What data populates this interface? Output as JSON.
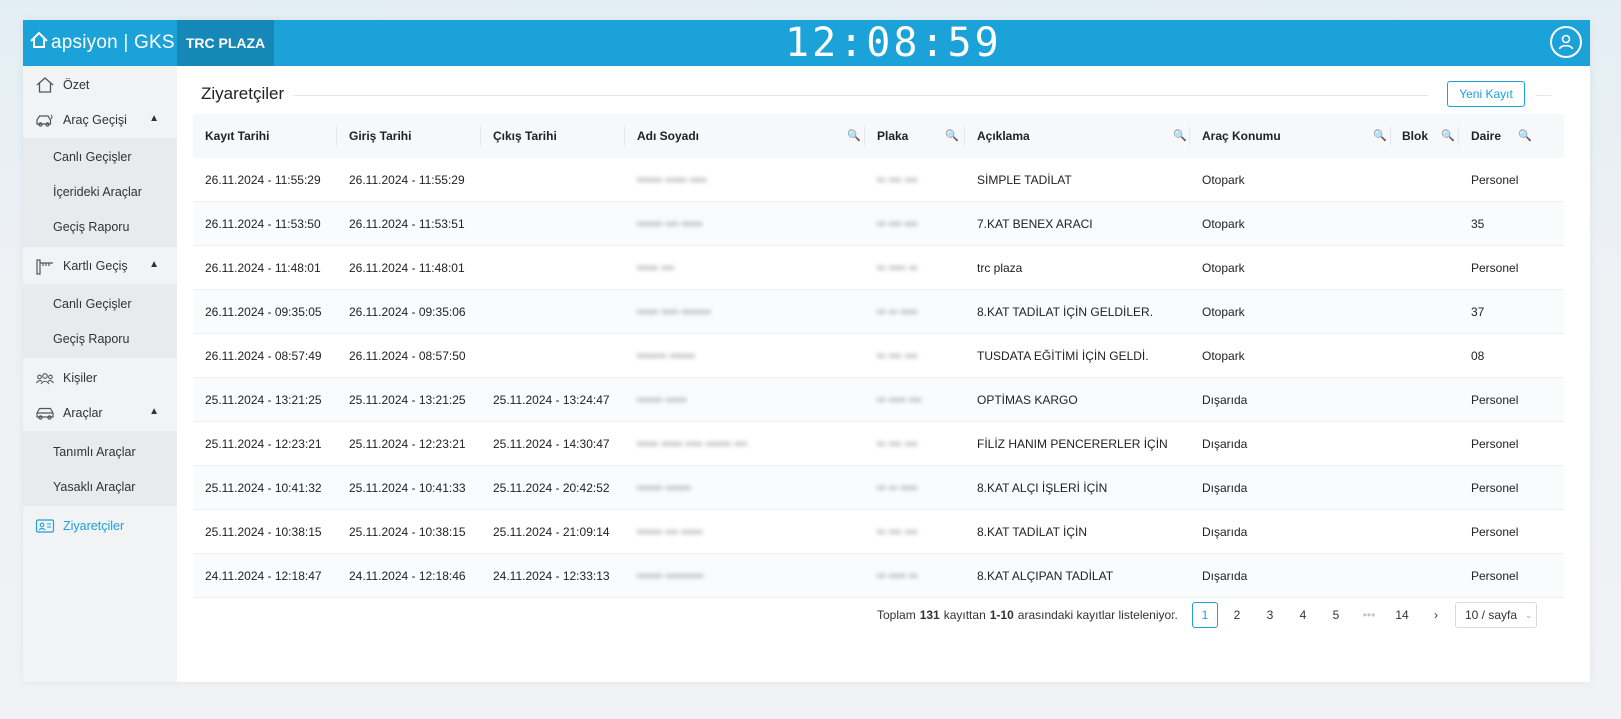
{
  "topbar": {
    "brand": "apsiyon | GKS",
    "site": "TRC PLAZA",
    "clock": "12:08:59"
  },
  "sidebar": {
    "summary": "Özet",
    "vehicle_pass": {
      "label": "Araç Geçişi",
      "items": [
        "Canlı Geçişler",
        "İçerideki Araçlar",
        "Geçiş Raporu"
      ]
    },
    "card_pass": {
      "label": "Kartlı Geçiş",
      "items": [
        "Canlı Geçişler",
        "Geçiş Raporu"
      ]
    },
    "people": "Kişiler",
    "vehicles": {
      "label": "Araçlar",
      "items": [
        "Tanımlı Araçlar",
        "Yasaklı Araçlar"
      ]
    },
    "visitors": "Ziyaretçiler"
  },
  "main": {
    "title": "Ziyaretçiler",
    "new_button": "Yeni Kayıt",
    "columns": [
      "Kayıt Tarihi",
      "Giriş Tarihi",
      "Çıkış Tarihi",
      "Adı Soyadı",
      "Plaka",
      "Açıklama",
      "Araç Konumu",
      "Blok",
      "Daire"
    ],
    "rows": [
      {
        "kayit": "26.11.2024 - 11:55:29",
        "giris": "26.11.2024 - 11:55:29",
        "cikis": "",
        "ad": "•••••• ••••• ••••",
        "plaka": "•• ••• •••",
        "aciklama": "SİMPLE TADİLAT",
        "konum": "Otopark",
        "blok": "",
        "daire": "Personel"
      },
      {
        "kayit": "26.11.2024 - 11:53:50",
        "giris": "26.11.2024 - 11:53:51",
        "cikis": "",
        "ad": "•••••• ••• •••••",
        "plaka": "•• ••• •••",
        "aciklama": "7.KAT BENEX ARACI",
        "konum": "Otopark",
        "blok": "",
        "daire": "35"
      },
      {
        "kayit": "26.11.2024 - 11:48:01",
        "giris": "26.11.2024 - 11:48:01",
        "cikis": "",
        "ad": "••••• •••",
        "plaka": "•• •••• ••",
        "aciklama": "trc plaza",
        "konum": "Otopark",
        "blok": "",
        "daire": "Personel"
      },
      {
        "kayit": "26.11.2024 - 09:35:05",
        "giris": "26.11.2024 - 09:35:06",
        "cikis": "",
        "ad": "••••• •••• •••••••",
        "plaka": "•• •• ••••",
        "aciklama": "8.KAT TADİLAT İÇİN GELDİLER.",
        "konum": "Otopark",
        "blok": "",
        "daire": "37"
      },
      {
        "kayit": "26.11.2024 - 08:57:49",
        "giris": "26.11.2024 - 08:57:50",
        "cikis": "",
        "ad": "••••••• ••••••",
        "plaka": "•• ••• •••",
        "aciklama": "TUSDATA EĞİTİMİ İÇİN GELDİ.",
        "konum": "Otopark",
        "blok": "",
        "daire": "08"
      },
      {
        "kayit": "25.11.2024 - 13:21:25",
        "giris": "25.11.2024 - 13:21:25",
        "cikis": "25.11.2024 - 13:24:47",
        "ad": "•••••• •••••",
        "plaka": "•• •••• •••",
        "aciklama": "OPTİMAS KARGO",
        "konum": "Dışarıda",
        "blok": "",
        "daire": "Personel"
      },
      {
        "kayit": "25.11.2024 - 12:23:21",
        "giris": "25.11.2024 - 12:23:21",
        "cikis": "25.11.2024 - 14:30:47",
        "ad": "••••• ••••• •••• •••••• •••",
        "plaka": "•• ••• •••",
        "aciklama": "FİLİZ HANIM PENCERERLER İÇİN",
        "konum": "Dışarıda",
        "blok": "",
        "daire": "Personel"
      },
      {
        "kayit": "25.11.2024 - 10:41:32",
        "giris": "25.11.2024 - 10:41:33",
        "cikis": "25.11.2024 - 20:42:52",
        "ad": "•••••• ••••••",
        "plaka": "•• •• ••••",
        "aciklama": "8.KAT ALÇI İŞLERİ İÇİN",
        "konum": "Dışarıda",
        "blok": "",
        "daire": "Personel"
      },
      {
        "kayit": "25.11.2024 - 10:38:15",
        "giris": "25.11.2024 - 10:38:15",
        "cikis": "25.11.2024 - 21:09:14",
        "ad": "•••••• ••• •••••",
        "plaka": "•• ••• •••",
        "aciklama": "8.KAT TADİLAT İÇİN",
        "konum": "Dışarıda",
        "blok": "",
        "daire": "Personel"
      },
      {
        "kayit": "24.11.2024 - 12:18:47",
        "giris": "24.11.2024 - 12:18:46",
        "cikis": "24.11.2024 - 12:33:13",
        "ad": "•••••• •••••••••",
        "plaka": "•• •••• ••",
        "aciklama": "8.KAT ALÇIPAN TADİLAT",
        "konum": "Dışarıda",
        "blok": "",
        "daire": "Personel"
      }
    ],
    "pager": {
      "prefix": "Toplam",
      "total": "131",
      "mid": "kayıttan",
      "range": "1-10",
      "suffix": "arasındaki kayıtlar listeleniyor.",
      "pages": [
        "1",
        "2",
        "3",
        "4",
        "5"
      ],
      "ellipsis": "•••",
      "last": "14",
      "prev": "‹",
      "next": "›",
      "page_size": "10 / sayfa"
    }
  },
  "colors": {
    "accent": "#1ba2d8",
    "site_tab": "#1688b8"
  }
}
